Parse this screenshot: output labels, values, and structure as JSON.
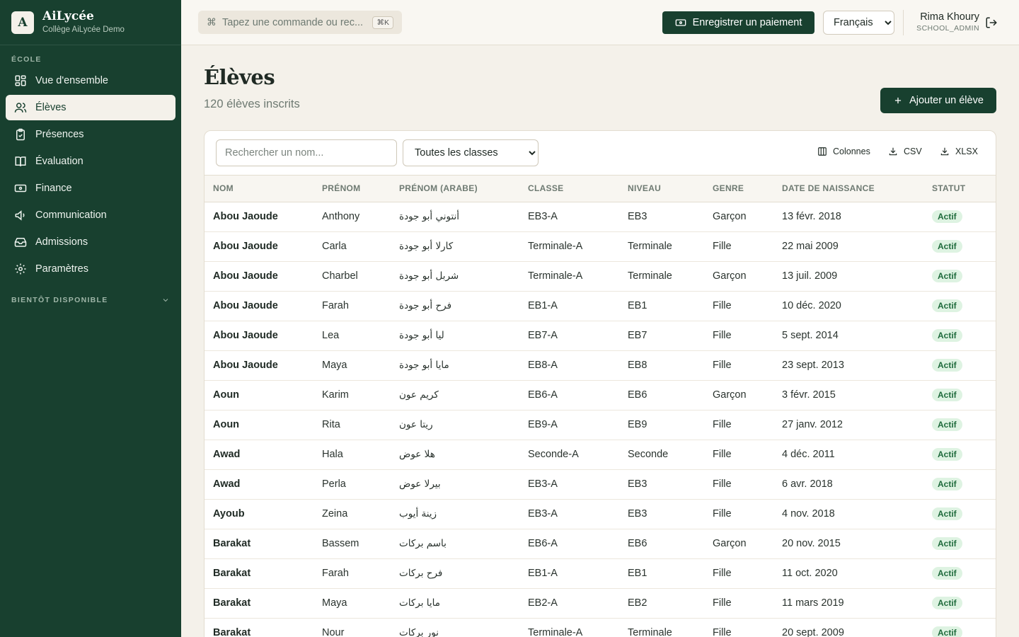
{
  "brand": {
    "logo_letter": "A",
    "name": "AiLycée",
    "subtitle": "Collège AiLycée Demo"
  },
  "sidebar": {
    "section_label": "ÉCOLE",
    "items": [
      {
        "label": "Vue d'ensemble",
        "icon": "dashboard-icon",
        "active": false
      },
      {
        "label": "Élèves",
        "icon": "users-icon",
        "active": true
      },
      {
        "label": "Présences",
        "icon": "clipboard-check-icon",
        "active": false
      },
      {
        "label": "Évaluation",
        "icon": "book-icon",
        "active": false
      },
      {
        "label": "Finance",
        "icon": "banknote-icon",
        "active": false
      },
      {
        "label": "Communication",
        "icon": "megaphone-icon",
        "active": false
      },
      {
        "label": "Admissions",
        "icon": "inbox-icon",
        "active": false
      },
      {
        "label": "Paramètres",
        "icon": "gear-icon",
        "active": false
      }
    ],
    "soon_label": "BIENTÔT DISPONIBLE"
  },
  "topbar": {
    "command_placeholder": "Tapez une commande ou rec...",
    "command_glyph": "⌘",
    "command_shortcut": "⌘K",
    "pay_button": "Enregistrer un paiement",
    "language": "Français",
    "user_name": "Rima Khoury",
    "user_role": "SCHOOL_ADMIN"
  },
  "page": {
    "title": "Élèves",
    "subtitle": "120 élèves inscrits",
    "add_button": "Ajouter un élève"
  },
  "filters": {
    "search_placeholder": "Rechercher un nom...",
    "class_filter": "Toutes les classes",
    "columns_label": "Colonnes",
    "csv_label": "CSV",
    "xlsx_label": "XLSX"
  },
  "table": {
    "headers": [
      "NOM",
      "PRÉNOM",
      "PRÉNOM (ARABE)",
      "CLASSE",
      "NIVEAU",
      "GENRE",
      "DATE DE NAISSANCE",
      "STATUT"
    ],
    "rows": [
      [
        "Abou Jaoude",
        "Anthony",
        "أنتوني أبو جودة",
        "EB3-A",
        "EB3",
        "Garçon",
        "13 févr. 2018",
        "Actif"
      ],
      [
        "Abou Jaoude",
        "Carla",
        "كارلا أبو جودة",
        "Terminale-A",
        "Terminale",
        "Fille",
        "22 mai 2009",
        "Actif"
      ],
      [
        "Abou Jaoude",
        "Charbel",
        "شربل أبو جودة",
        "Terminale-A",
        "Terminale",
        "Garçon",
        "13 juil. 2009",
        "Actif"
      ],
      [
        "Abou Jaoude",
        "Farah",
        "فرح أبو جودة",
        "EB1-A",
        "EB1",
        "Fille",
        "10 déc. 2020",
        "Actif"
      ],
      [
        "Abou Jaoude",
        "Lea",
        "ليا أبو جودة",
        "EB7-A",
        "EB7",
        "Fille",
        "5 sept. 2014",
        "Actif"
      ],
      [
        "Abou Jaoude",
        "Maya",
        "مايا أبو جودة",
        "EB8-A",
        "EB8",
        "Fille",
        "23 sept. 2013",
        "Actif"
      ],
      [
        "Aoun",
        "Karim",
        "كريم عون",
        "EB6-A",
        "EB6",
        "Garçon",
        "3 févr. 2015",
        "Actif"
      ],
      [
        "Aoun",
        "Rita",
        "ريتا عون",
        "EB9-A",
        "EB9",
        "Fille",
        "27 janv. 2012",
        "Actif"
      ],
      [
        "Awad",
        "Hala",
        "هلا عوض",
        "Seconde-A",
        "Seconde",
        "Fille",
        "4 déc. 2011",
        "Actif"
      ],
      [
        "Awad",
        "Perla",
        "بيرلا عوض",
        "EB3-A",
        "EB3",
        "Fille",
        "6 avr. 2018",
        "Actif"
      ],
      [
        "Ayoub",
        "Zeina",
        "زينة أيوب",
        "EB3-A",
        "EB3",
        "Fille",
        "4 nov. 2018",
        "Actif"
      ],
      [
        "Barakat",
        "Bassem",
        "باسم بركات",
        "EB6-A",
        "EB6",
        "Garçon",
        "20 nov. 2015",
        "Actif"
      ],
      [
        "Barakat",
        "Farah",
        "فرح بركات",
        "EB1-A",
        "EB1",
        "Fille",
        "11 oct. 2020",
        "Actif"
      ],
      [
        "Barakat",
        "Maya",
        "مايا بركات",
        "EB2-A",
        "EB2",
        "Fille",
        "11 mars 2019",
        "Actif"
      ],
      [
        "Barakat",
        "Nour",
        "نور بركات",
        "Terminale-A",
        "Terminale",
        "Fille",
        "20 sept. 2009",
        "Actif"
      ]
    ]
  },
  "colors": {
    "sidebar_bg": "#18402f",
    "accent": "#18402f",
    "page_bg": "#f4f1ea",
    "badge_bg": "#def3e2",
    "badge_fg": "#1f6b3c"
  }
}
